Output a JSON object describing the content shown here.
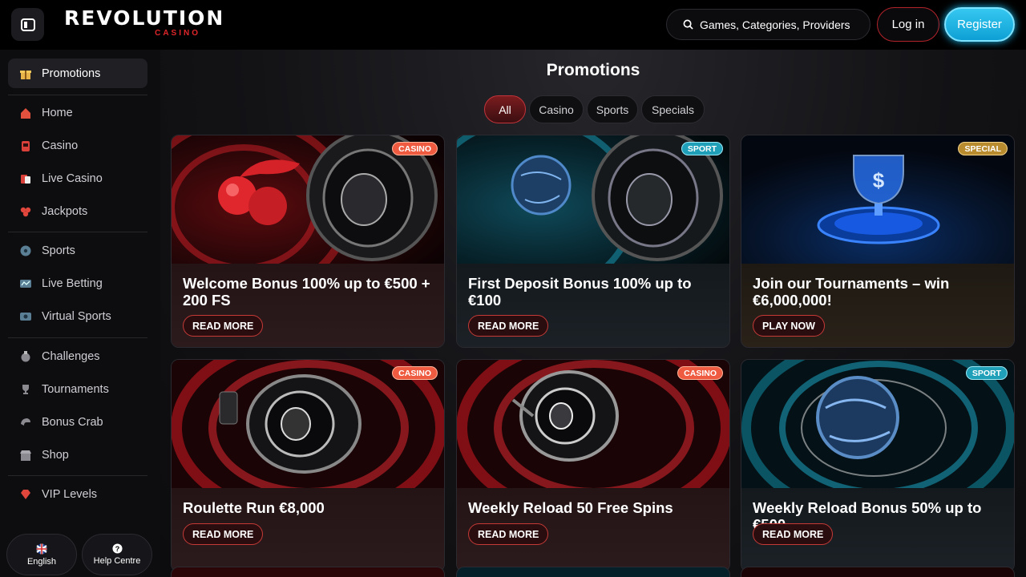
{
  "header": {
    "logo_main": "REVOLUTION",
    "logo_sub": "CASINO",
    "search_placeholder": "Games, Categories, Providers",
    "login_label": "Log in",
    "register_label": "Register"
  },
  "sidebar": {
    "items": [
      {
        "label": "Promotions",
        "icon": "gift-icon"
      },
      {
        "label": "Home",
        "icon": "home-icon"
      },
      {
        "label": "Casino",
        "icon": "slot-machine-icon"
      },
      {
        "label": "Live Casino",
        "icon": "live-cards-icon"
      },
      {
        "label": "Jackpots",
        "icon": "clover-icon"
      },
      {
        "label": "Sports",
        "icon": "soccer-ball-icon"
      },
      {
        "label": "Live Betting",
        "icon": "live-tv-icon"
      },
      {
        "label": "Virtual Sports",
        "icon": "virtual-console-icon"
      },
      {
        "label": "Challenges",
        "icon": "challenge-icon"
      },
      {
        "label": "Tournaments",
        "icon": "trophy-icon"
      },
      {
        "label": "Bonus Crab",
        "icon": "crab-claw-icon"
      },
      {
        "label": "Shop",
        "icon": "shop-icon"
      },
      {
        "label": "VIP Levels",
        "icon": "diamond-icon"
      }
    ],
    "language_label": "English",
    "help_label": "Help Centre"
  },
  "main": {
    "title": "Promotions",
    "filters": [
      "All",
      "Casino",
      "Sports",
      "Specials"
    ],
    "cards": [
      {
        "title": "Welcome Bonus 100% up to €500 + 200 FS",
        "cta": "READ MORE",
        "badge": "CASINO"
      },
      {
        "title": "First Deposit Bonus 100% up to €100",
        "cta": "READ MORE",
        "badge": "SPORT"
      },
      {
        "title": "Join our Tournaments – win €6,000,000!",
        "cta": "PLAY NOW",
        "badge": "SPECIAL"
      },
      {
        "title": "Roulette Run €8,000",
        "cta": "READ MORE",
        "badge": "CASINO"
      },
      {
        "title": "Weekly Reload 50 Free Spins",
        "cta": "READ MORE",
        "badge": "CASINO"
      },
      {
        "title": "Weekly Reload Bonus 50% up to €500",
        "cta": "READ MORE",
        "badge": "SPORT"
      }
    ]
  },
  "colors": {
    "brand_red": "#e0262b",
    "register_blue": "#18b8ee",
    "casino_badge": "#ee5b40",
    "sport_badge": "#1f9fb8",
    "special_badge": "#b88b2f"
  }
}
